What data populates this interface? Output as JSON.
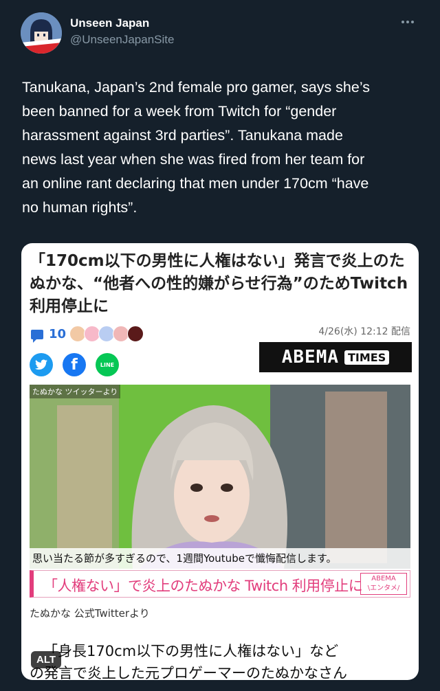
{
  "account": {
    "display_name": "Unseen Japan",
    "handle": "@UnseenJapanSite"
  },
  "tweet": {
    "text": "Tanukana, Japan’s 2nd female pro gamer, says she’s\nbeen banned for a week from Twitch for “gender\nharassment against 3rd parties”. Tanukana made\nnews last year when she was fired from her team for\nan online rant declaring that men under 170cm “have\nno human rights”."
  },
  "media": {
    "headline": "「170cm以下の男性に人権はない」発言で炎上のたぬかな、“他者への性的嫌がらせ行為”のためTwitch利用停止に",
    "comment_count": "10",
    "date": "4/26(水) 12:12 配信",
    "social": {
      "line_label": "LINE"
    },
    "abema_logo": {
      "main": "ABEMA",
      "times": "TIMES"
    },
    "photo_tag": "たぬかな ツイッターより",
    "photo_caption": "思い当たる節が多すぎるので、1週間Youtubeで懺悔配信します。",
    "banner_text": "「人権ない」で炎上のたぬかな Twitch 利用停止に",
    "banner_logo": {
      "line1": "ABEMA",
      "line2": "\\エンタメ/"
    },
    "source": "たぬかな 公式Twitterより",
    "body_text": "   「身長170cm以下の男性に人権はない」など\nの発言で炎上した元プロゲーマーのたぬかなさん",
    "alt_label": "ALT"
  },
  "colors": {
    "background": "#15202b",
    "secondary_text": "#8899a6",
    "abema_pink": "#e23d7c",
    "twitter_blue": "#1d9bf0",
    "facebook_blue": "#1877f2",
    "line_green": "#06c755"
  },
  "icons": [
    "more-icon",
    "comment-icon",
    "twitter-icon",
    "facebook-icon",
    "line-icon"
  ]
}
